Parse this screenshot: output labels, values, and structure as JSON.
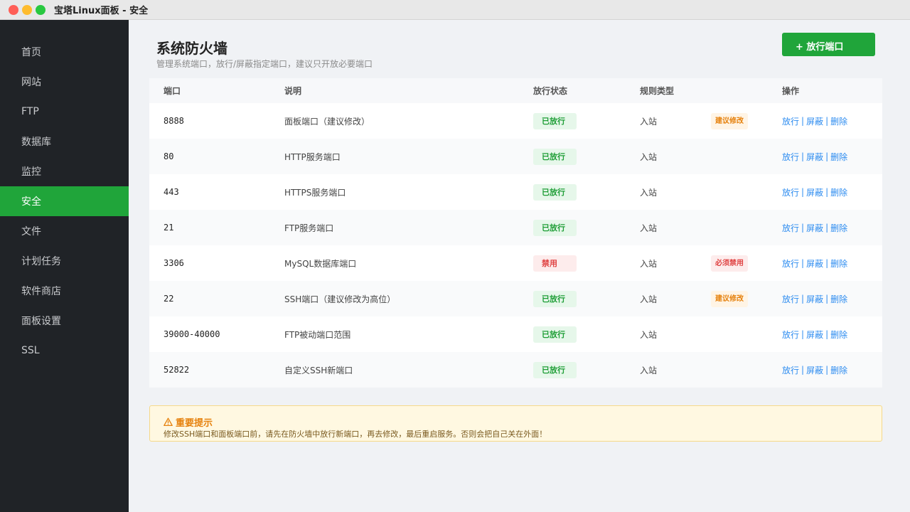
{
  "window": {
    "title": "宝塔Linux面板 - 安全"
  },
  "sidebar": {
    "items": [
      {
        "label": "首页",
        "active": false
      },
      {
        "label": "网站",
        "active": false
      },
      {
        "label": "FTP",
        "active": false
      },
      {
        "label": "数据库",
        "active": false
      },
      {
        "label": "监控",
        "active": false
      },
      {
        "label": "安全",
        "active": true
      },
      {
        "label": "文件",
        "active": false
      },
      {
        "label": "计划任务",
        "active": false
      },
      {
        "label": "软件商店",
        "active": false
      },
      {
        "label": "面板设置",
        "active": false
      },
      {
        "label": "SSL",
        "active": false
      }
    ]
  },
  "page": {
    "title": "系统防火墙",
    "description": "管理系统端口，放行/屏蔽指定端口，建议只开放必要端口",
    "add_button": "+ 放行端口"
  },
  "table": {
    "headers": {
      "port": "端口",
      "desc": "说明",
      "status": "放行状态",
      "rule": "规则类型",
      "ops": "操作"
    },
    "ops_labels": {
      "allow": "放行",
      "block": "屏蔽",
      "delete": "删除"
    },
    "rows": [
      {
        "port": "8888",
        "desc": "面板端口（建议修改）",
        "status": "已放行",
        "status_type": "ok",
        "rule": "入站",
        "tag": "建议修改",
        "tag_type": "warn"
      },
      {
        "port": "80",
        "desc": "HTTP服务端口",
        "status": "已放行",
        "status_type": "ok",
        "rule": "入站",
        "tag": "",
        "tag_type": ""
      },
      {
        "port": "443",
        "desc": "HTTPS服务端口",
        "status": "已放行",
        "status_type": "ok",
        "rule": "入站",
        "tag": "",
        "tag_type": ""
      },
      {
        "port": "21",
        "desc": "FTP服务端口",
        "status": "已放行",
        "status_type": "ok",
        "rule": "入站",
        "tag": "",
        "tag_type": ""
      },
      {
        "port": "3306",
        "desc": "MySQL数据库端口",
        "status": "禁用",
        "status_type": "ban",
        "rule": "入站",
        "tag": "必须禁用",
        "tag_type": "danger"
      },
      {
        "port": "22",
        "desc": "SSH端口（建议修改为高位）",
        "status": "已放行",
        "status_type": "ok",
        "rule": "入站",
        "tag": "建议修改",
        "tag_type": "warn"
      },
      {
        "port": "39000-40000",
        "desc": "FTP被动端口范围",
        "status": "已放行",
        "status_type": "ok",
        "rule": "入站",
        "tag": "",
        "tag_type": ""
      },
      {
        "port": "52822",
        "desc": "自定义SSH新端口",
        "status": "已放行",
        "status_type": "ok",
        "rule": "入站",
        "tag": "",
        "tag_type": ""
      }
    ]
  },
  "notice": {
    "title": "重要提示",
    "icon": "warning-icon",
    "text": "修改SSH端口和面板端口前，请先在防火墙中放行新端口，再去修改，最后重启服务。否则会把自己关在外面！"
  },
  "colors": {
    "accent": "#20a53a",
    "sidebar_bg": "#202327",
    "link": "#2d8cf0",
    "warning": "#e6820e",
    "danger": "#e04444"
  }
}
